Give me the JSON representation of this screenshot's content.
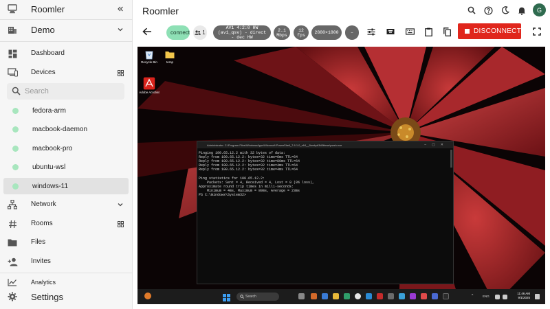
{
  "sidebar": {
    "brand": "Roomler",
    "collapse_icon": "double-chevron-left-icon",
    "org": "Demo",
    "nav": {
      "dashboard": "Dashboard",
      "devices": "Devices",
      "network": "Network",
      "rooms": "Rooms",
      "files": "Files",
      "invites": "Invites",
      "analytics": "Analytics",
      "settings": "Settings"
    },
    "search_placeholder": "Search",
    "devices": [
      "fedora-arm",
      "macbook-daemon",
      "macbook-pro",
      "ubuntu-wsl",
      "windows-11"
    ],
    "active_device": "windows-11",
    "status_color": "#a8e6be"
  },
  "header": {
    "title": "Roomler",
    "avatar": "G",
    "avatar_color": "#2f6b4f"
  },
  "toolbar": {
    "status": "connected",
    "viewers": "1",
    "codec": "AV1 4:2:0 HW (av1_qsv) - direct - dec HW",
    "bitrate": "2.1 Mbps",
    "fps": "12 fps",
    "resolution": "2880×1800",
    "extra": "–",
    "disconnect_label": "DISCONNECT",
    "disconnect_color": "#e0261c"
  },
  "remote": {
    "desktop_icons": [
      "Recycle Bin",
      "temp",
      "Adobe Acrobat"
    ],
    "terminal": {
      "title": "Administrator: C:\\Program Files\\WindowsApps\\Microsoft.PowerShell_7.6.1.0_x64__8wekyb3d8bbwe\\pwsh.exe",
      "lines": [
        "Pinging 100.65.12.2 with 32 bytes of data:",
        "Reply from 100.65.12.2: bytes=32 time=6ms TTL=64",
        "Reply from 100.65.12.2: bytes=32 time=80ms TTL=64",
        "Reply from 100.65.12.2: bytes=32 time=4ms TTL=64",
        "Reply from 100.65.12.2: bytes=32 time=4ms TTL=64",
        "",
        "Ping statistics for 100.65.12.2:",
        "    Packets: Sent = 4, Received = 4, Lost = 0 (0% loss),",
        "Approximate round trip times in milli-seconds:",
        "    Minimum = 4ms, Maximum = 80ms, Average = 23ms",
        "PS C:\\Windows\\System32>"
      ]
    },
    "taskbar": {
      "search": "Search",
      "language": "ENG",
      "time": "11:46 AM",
      "date": "9/1/2025"
    }
  }
}
